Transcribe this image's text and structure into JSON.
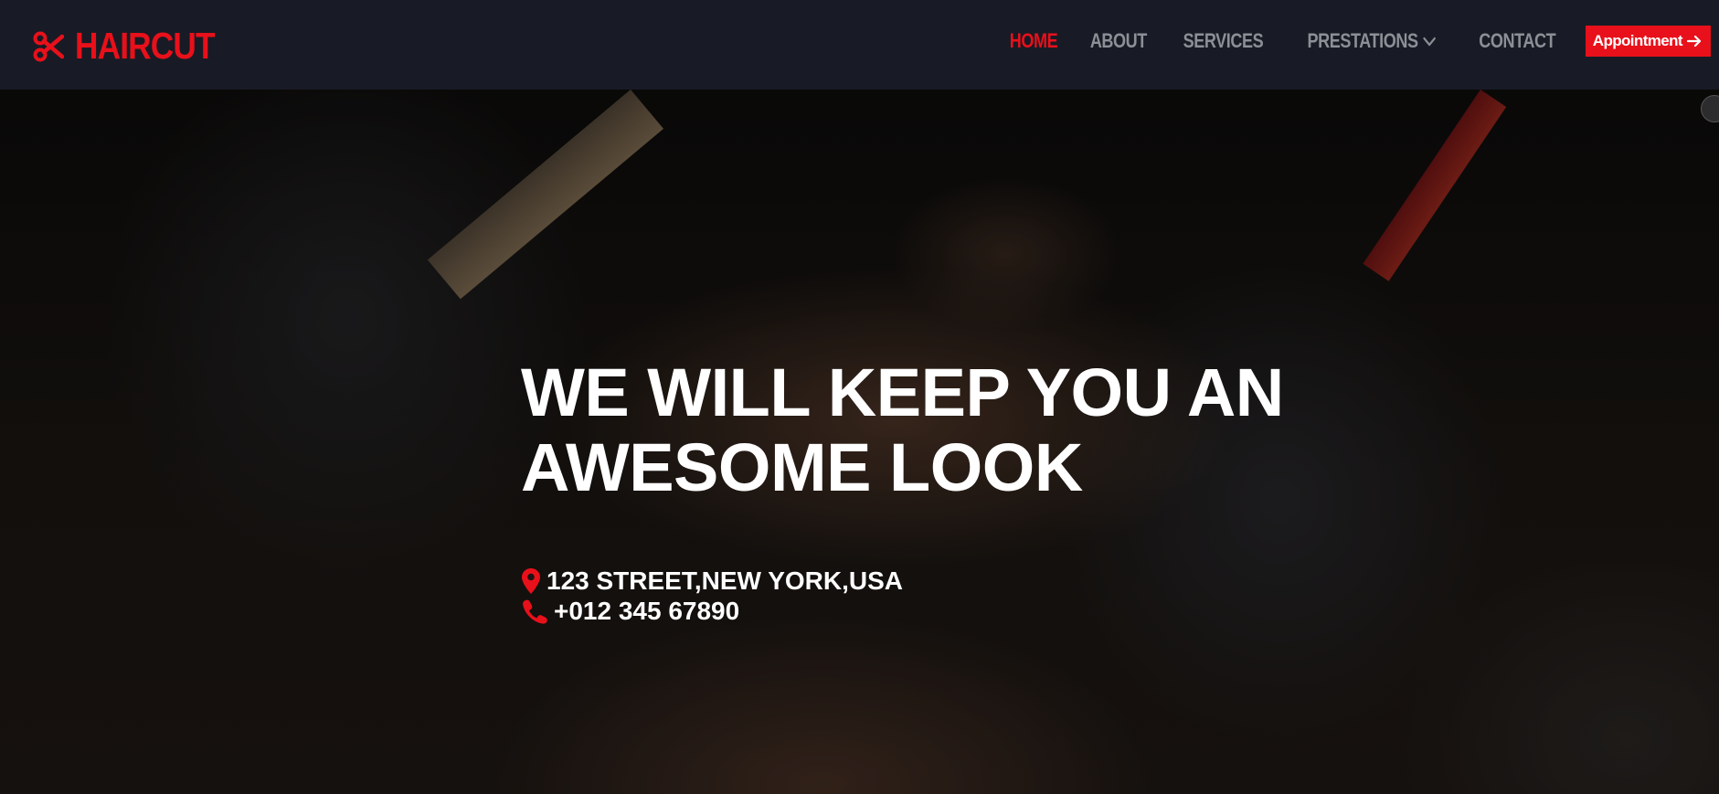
{
  "brand": {
    "name": "HAIRCUT",
    "icon": "scissors-icon",
    "color": "#e8101a"
  },
  "nav": {
    "items": [
      {
        "label": "HOME",
        "active": true
      },
      {
        "label": "ABOUT",
        "active": false
      },
      {
        "label": "SERVICES",
        "active": false
      },
      {
        "label": "PRESTATIONS",
        "active": false,
        "icon": "chevron-down-icon"
      },
      {
        "label": "CONTACT",
        "active": false
      }
    ],
    "cta_label": "Appointment",
    "cta_icon": "arrow-right-icon"
  },
  "hero": {
    "title": "WE WILL KEEP YOU AN AWESOME LOOK",
    "address": "123 STREET,NEW YORK,USA",
    "address_icon": "map-pin-icon",
    "phone": "+012 345 67890",
    "phone_icon": "phone-icon"
  },
  "colors": {
    "accent": "#e8101a",
    "navbar_bg": "#181b25",
    "nav_text": "#8d8f96",
    "hero_text": "#ffffff"
  }
}
